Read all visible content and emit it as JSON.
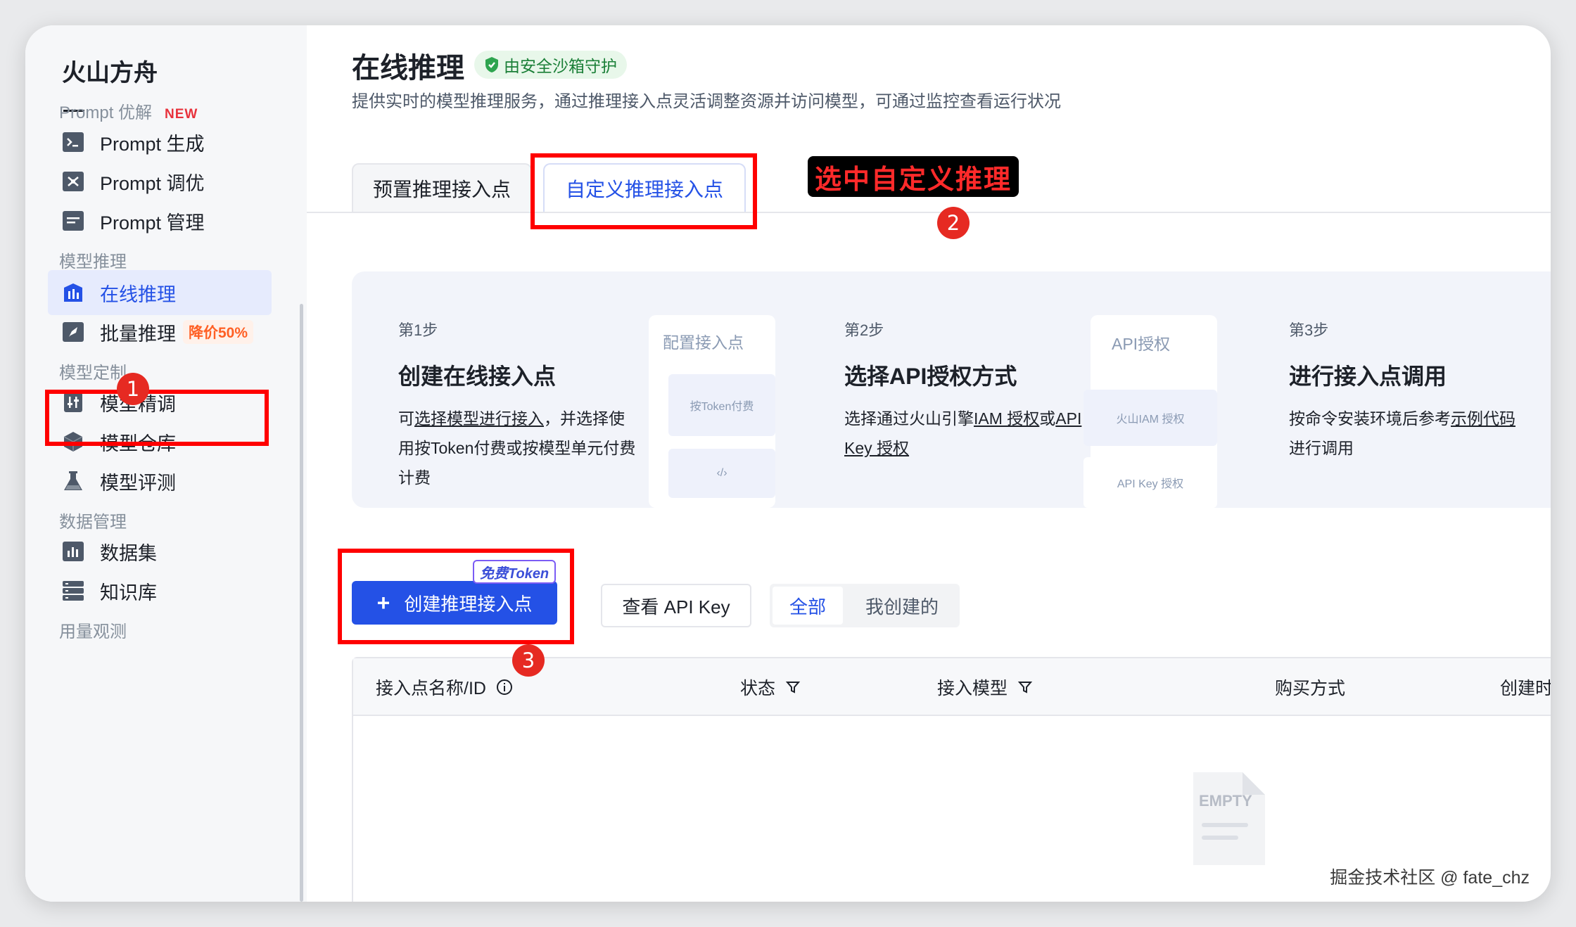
{
  "sidebar": {
    "brand": "火山方舟",
    "sections": {
      "prompt_optimize": "Prompt 优解",
      "new_badge": "NEW",
      "model_inference": "模型推理",
      "model_custom": "模型定制",
      "data_manage": "数据管理",
      "usage_monitor": "用量观测"
    },
    "items": [
      {
        "label": "Prompt 生成",
        "icon": "terminal-icon"
      },
      {
        "label": "Prompt 调优",
        "icon": "tune-icon"
      },
      {
        "label": "Prompt 管理",
        "icon": "document-list-icon"
      },
      {
        "label": "在线推理",
        "icon": "bar-chart-icon"
      },
      {
        "label": "批量推理",
        "icon": "rocket-icon",
        "badge": "降价50%"
      },
      {
        "label": "模型精调",
        "icon": "sliders-icon"
      },
      {
        "label": "模型仓库",
        "icon": "cube-icon"
      },
      {
        "label": "模型评测",
        "icon": "flask-icon"
      },
      {
        "label": "数据集",
        "icon": "chart-box-icon"
      },
      {
        "label": "知识库",
        "icon": "database-icon"
      }
    ]
  },
  "header": {
    "title": "在线推理",
    "safe_tag": "由安全沙箱守护",
    "subtitle": "提供实时的模型推理服务，通过推理接入点灵活调整资源并访问模型，可通过监控查看运行状况"
  },
  "tabs": [
    {
      "label": "预置推理接入点",
      "active": false
    },
    {
      "label": "自定义推理接入点",
      "active": true
    }
  ],
  "annotations": {
    "label": "选中自定义推理",
    "badge1": "1",
    "badge2": "2",
    "badge3": "3"
  },
  "steps": [
    {
      "num": "第1步",
      "title": "创建在线接入点",
      "desc_pre": "可",
      "desc_link": "选择模型进行接入",
      "desc_post": "，并选择使用按Token付费或按模型单元付费计费"
    },
    {
      "num": "第2步",
      "title": "选择API授权方式",
      "desc_pre": "选择通过火山引擎",
      "desc_link": "IAM 授权",
      "desc_mid": "或",
      "desc_link2": "API Key 授权"
    },
    {
      "num": "第3步",
      "title": "进行接入点调用",
      "desc_pre": "按命令安装环境后参考",
      "desc_link": "示例代码",
      "desc_post": "进行调用"
    }
  ],
  "illustrations": {
    "config_title": "配置接入点",
    "config_chip": "按Token付费",
    "api_title": "API授权",
    "api_chip1": "火山IAM 授权",
    "api_chip2": "API Key 授权"
  },
  "actions": {
    "create_label": "创建推理接入点",
    "token_tag": "免费Token",
    "view_api_key": "查看 API Key",
    "filter_all": "全部",
    "filter_mine": "我创建的"
  },
  "table": {
    "columns": [
      "接入点名称/ID",
      "状态",
      "接入模型",
      "购买方式",
      "创建时"
    ],
    "empty_text": "EMPTY"
  },
  "watermark": "掘金技术社区 @ fate_chz",
  "colors": {
    "primary": "#2451e6",
    "annotation_red": "#ff0000",
    "safe_green": "#1a7f37",
    "discount_orange": "#ff5f24"
  }
}
